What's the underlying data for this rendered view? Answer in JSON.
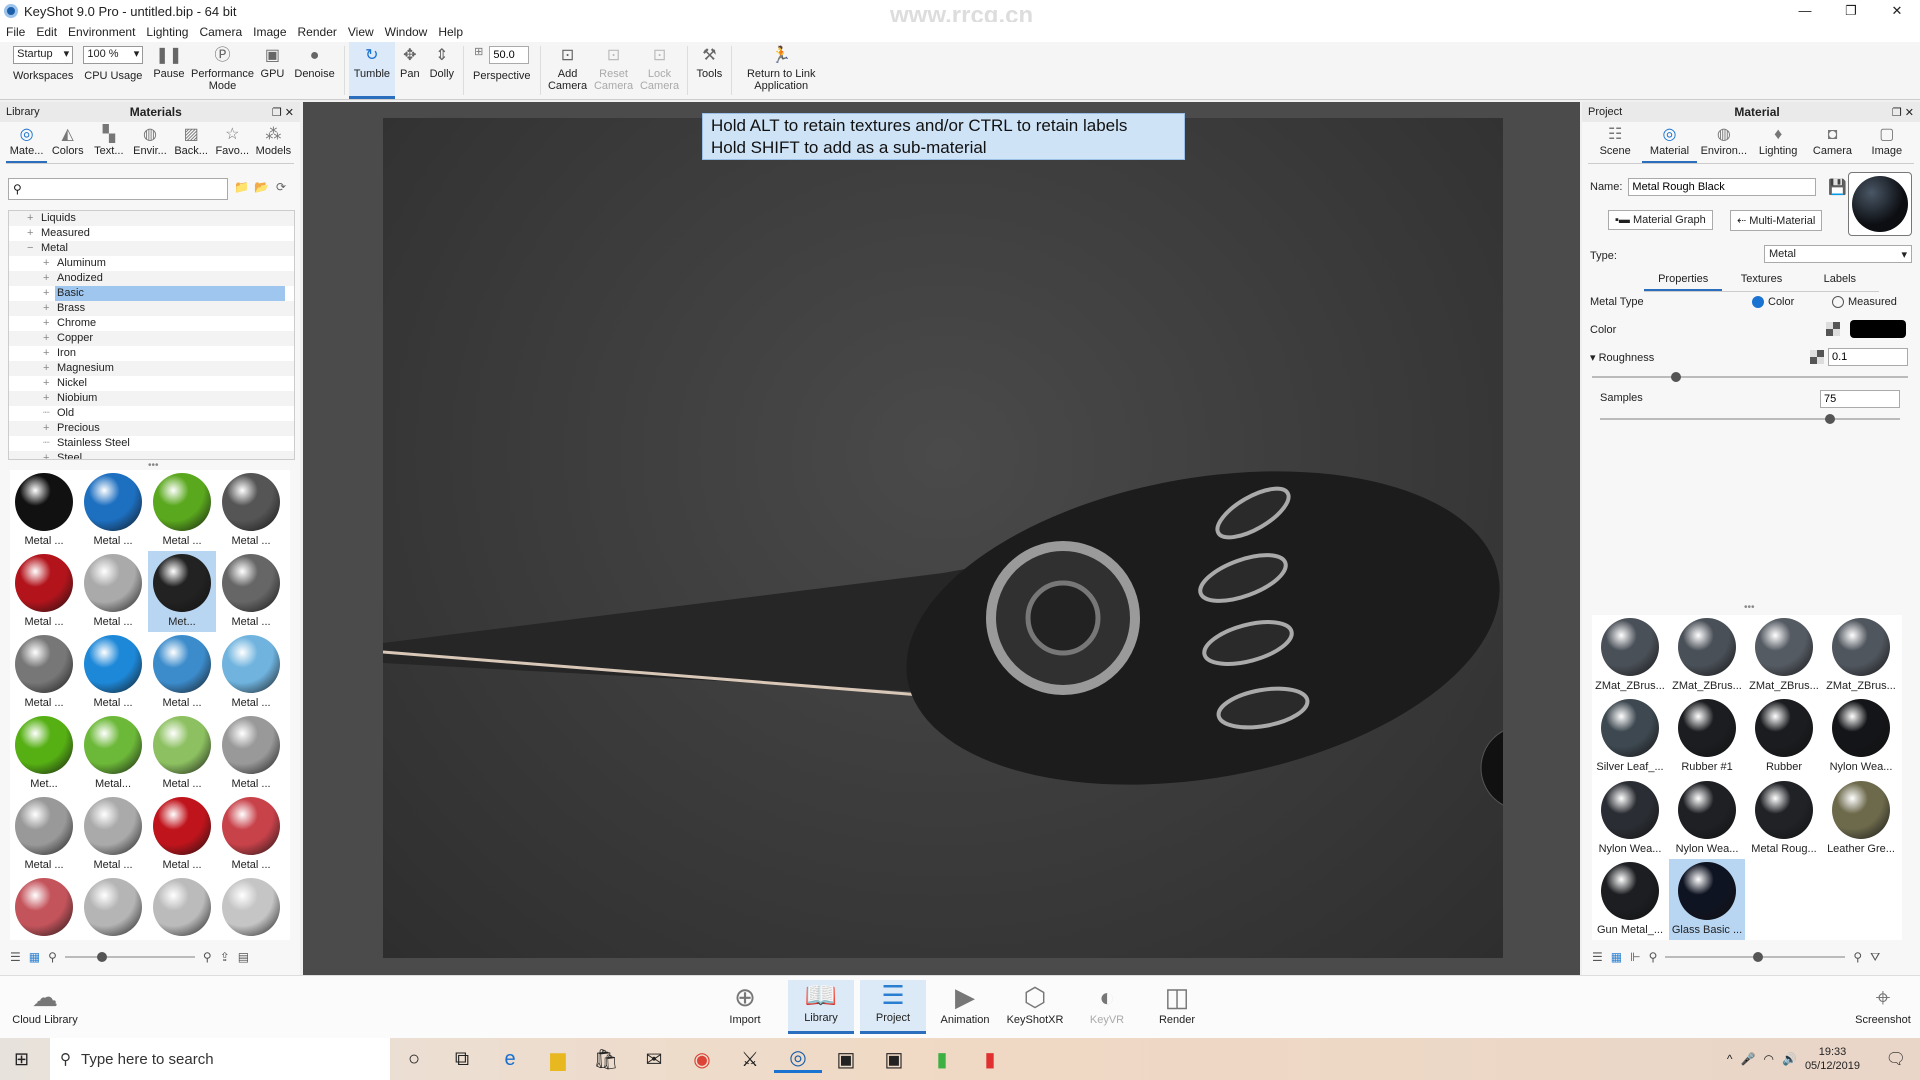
{
  "window": {
    "title": "KeyShot 9.0 Pro  - untitled.bip  - 64 bit",
    "controls": [
      "—",
      "❐",
      "✕"
    ]
  },
  "menu": [
    "File",
    "Edit",
    "Environment",
    "Lighting",
    "Camera",
    "Image",
    "Render",
    "View",
    "Window",
    "Help"
  ],
  "toolbar": {
    "workspace": "Startup",
    "workspace_label": "Workspaces",
    "cpu": "100 %",
    "cpu_label": "CPU Usage",
    "pause": "Pause",
    "performance": "Performance Mode",
    "gpu": "GPU",
    "denoise": "Denoise",
    "tumble": "Tumble",
    "pan": "Pan",
    "dolly": "Dolly",
    "fov": "50.0",
    "perspective": "Perspective",
    "add_camera": "Add Camera",
    "reset_camera": "Reset Camera",
    "lock_camera": "Lock Camera",
    "tools": "Tools",
    "return": "Return to Link Application"
  },
  "watermark": "www.rrcg.cn",
  "library": {
    "left_title": "Library",
    "title": "Materials",
    "tabs": [
      "Mate...",
      "Colors",
      "Text...",
      "Envir...",
      "Back...",
      "Favo...",
      "Models"
    ],
    "search_placeholder": "",
    "tree": [
      {
        "label": "Liquids",
        "level": 1,
        "sign": "+"
      },
      {
        "label": "Measured",
        "level": 1,
        "sign": "+"
      },
      {
        "label": "Metal",
        "level": 1,
        "sign": "−"
      },
      {
        "label": "Aluminum",
        "level": 2,
        "sign": "+"
      },
      {
        "label": "Anodized",
        "level": 2,
        "sign": "+"
      },
      {
        "label": "Basic",
        "level": 2,
        "sign": "+",
        "selected": true
      },
      {
        "label": "Brass",
        "level": 2,
        "sign": "+"
      },
      {
        "label": "Chrome",
        "level": 2,
        "sign": "+"
      },
      {
        "label": "Copper",
        "level": 2,
        "sign": "+"
      },
      {
        "label": "Iron",
        "level": 2,
        "sign": "+"
      },
      {
        "label": "Magnesium",
        "level": 2,
        "sign": "+"
      },
      {
        "label": "Nickel",
        "level": 2,
        "sign": "+"
      },
      {
        "label": "Niobium",
        "level": 2,
        "sign": "+"
      },
      {
        "label": "Old",
        "level": 2,
        "sign": "┈"
      },
      {
        "label": "Precious",
        "level": 2,
        "sign": "+"
      },
      {
        "label": "Stainless Steel",
        "level": 2,
        "sign": "┈"
      },
      {
        "label": "Steel",
        "level": 2,
        "sign": "+"
      }
    ],
    "materials": [
      {
        "label": "Metal ...",
        "color": "#111"
      },
      {
        "label": "Metal ...",
        "color": "#1d6fc0"
      },
      {
        "label": "Metal ...",
        "color": "#5aa81e"
      },
      {
        "label": "Metal ...",
        "color": "#555"
      },
      {
        "label": "Metal ...",
        "color": "#b3141c"
      },
      {
        "label": "Metal ...",
        "color": "#aaa"
      },
      {
        "label": "Met...",
        "color": "#222",
        "selected": true
      },
      {
        "label": "Metal ...",
        "color": "#666"
      },
      {
        "label": "Metal ...",
        "color": "#777"
      },
      {
        "label": "Metal ...",
        "color": "#1e88d8"
      },
      {
        "label": "Metal ...",
        "color": "#3c8ccc"
      },
      {
        "label": "Metal ...",
        "color": "#6fb3de"
      },
      {
        "label": "Met...",
        "color": "#56b014"
      },
      {
        "label": "Metal...",
        "color": "#6cb838"
      },
      {
        "label": "Metal ...",
        "color": "#8cc060"
      },
      {
        "label": "Metal ...",
        "color": "#999"
      },
      {
        "label": "Metal ...",
        "color": "#999"
      },
      {
        "label": "Metal ...",
        "color": "#aaa"
      },
      {
        "label": "Metal ...",
        "color": "#c0141c"
      },
      {
        "label": "Metal ...",
        "color": "#c8424a"
      },
      {
        "label": "",
        "color": "#c4545c"
      },
      {
        "label": "",
        "color": "#b5b5b5"
      },
      {
        "label": "",
        "color": "#bbb"
      },
      {
        "label": "",
        "color": "#c5c5c5"
      }
    ]
  },
  "hint": [
    "Hold ALT to retain textures and/or CTRL to retain labels",
    "Hold SHIFT to add as a sub-material"
  ],
  "project": {
    "left_title": "Project",
    "title": "Material",
    "tabs": [
      "Scene",
      "Material",
      "Environ...",
      "Lighting",
      "Camera",
      "Image"
    ],
    "name_label": "Name:",
    "name": "Metal Rough Black",
    "material_graph": "Material Graph",
    "multi_material": "Multi-Material",
    "type_label": "Type:",
    "type": "Metal",
    "subtabs": [
      "Properties",
      "Textures",
      "Labels"
    ],
    "metal_type_label": "Metal Type",
    "metal_type_options": [
      "Color",
      "Measured"
    ],
    "metal_type": "Color",
    "color_label": "Color",
    "color_value": "#000000",
    "roughness_label": "Roughness",
    "roughness": "0.1",
    "roughness_fraction": 0.1,
    "samples_label": "Samples",
    "samples": "75",
    "samples_fraction": 0.75,
    "materials": [
      {
        "label": "ZMat_ZBrus...",
        "color": "#4a5058"
      },
      {
        "label": "ZMat_ZBrus...",
        "color": "#4a5058"
      },
      {
        "label": "ZMat_ZBrus...",
        "color": "#555b63"
      },
      {
        "label": "ZMat_ZBrus...",
        "color": "#50565e"
      },
      {
        "label": "Silver Leaf_...",
        "color": "#3d4850"
      },
      {
        "label": "Rubber #1",
        "color": "#1b1d20"
      },
      {
        "label": "Rubber",
        "color": "#1a1c1f"
      },
      {
        "label": "Nylon Wea...",
        "color": "#141518"
      },
      {
        "label": "Nylon Wea...",
        "color": "#2a2d33"
      },
      {
        "label": "Nylon Wea...",
        "color": "#1e2024"
      },
      {
        "label": "Metal Roug...",
        "color": "#202226"
      },
      {
        "label": "Leather Gre...",
        "color": "#6d6a4c"
      },
      {
        "label": "Gun Metal_...",
        "color": "#1c1e21"
      },
      {
        "label": "Glass Basic ...",
        "color": "#0f1422",
        "selected": true
      }
    ]
  },
  "ribbon": {
    "cloud": "Cloud Library",
    "items": [
      "Import",
      "Library",
      "Project",
      "Animation",
      "KeyShotXR",
      "KeyVR",
      "Render"
    ],
    "screenshot": "Screenshot"
  },
  "taskbar": {
    "search_placeholder": "Type here to search",
    "time": "19:33",
    "date": "05/12/2019"
  }
}
